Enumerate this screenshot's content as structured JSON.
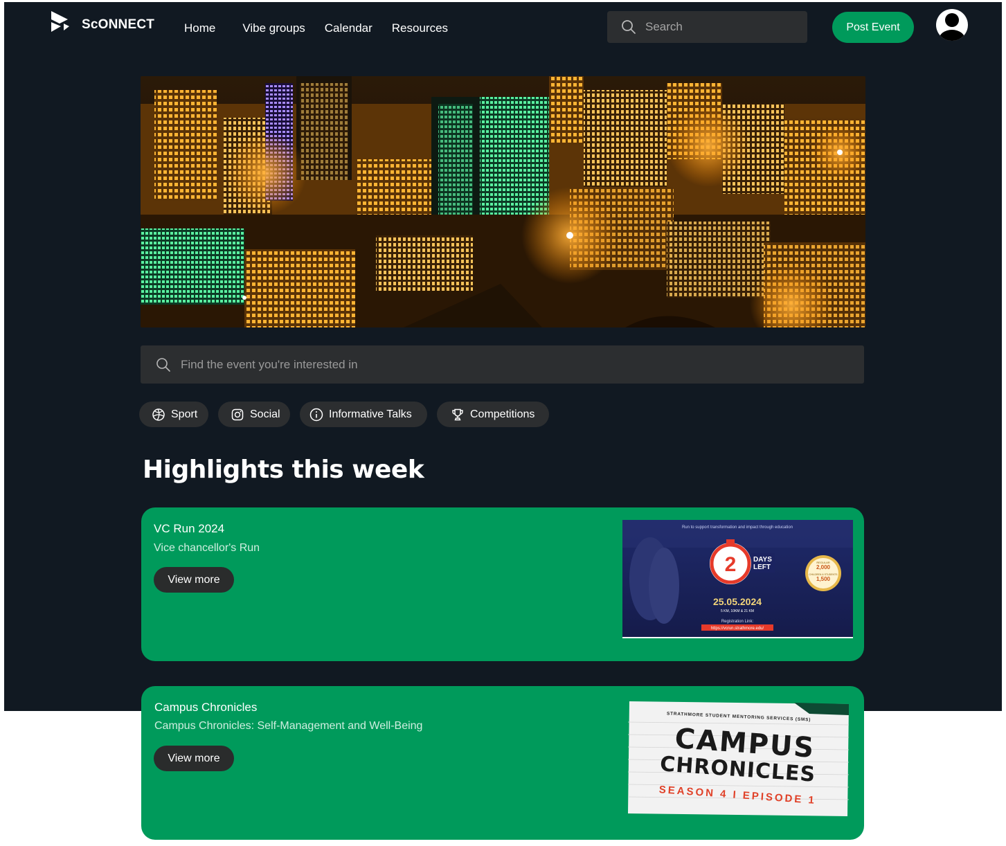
{
  "app": {
    "brand": "ScONNECT",
    "nav": [
      "Home",
      "Vibe groups",
      "Calendar",
      "Resources"
    ],
    "search_placeholder": "Search",
    "post_button": "Post Event"
  },
  "main": {
    "search_placeholder": "Find the event you're interested in",
    "categories": [
      {
        "label": "Sport",
        "icon": "basketball-icon"
      },
      {
        "label": "Social",
        "icon": "instagram-icon"
      },
      {
        "label": "Informative Talks",
        "icon": "info-icon"
      },
      {
        "label": "Competitions",
        "icon": "trophy-icon"
      }
    ],
    "section_title": "Highlights this week",
    "events": [
      {
        "title": "VC Run 2024",
        "subtitle": "Vice chancellor's Run",
        "button": "View more",
        "poster": {
          "tagline": "Run to support transformation and impact through education",
          "countdown": "2",
          "days_label": [
            "DAYS",
            "LEFT"
          ],
          "date": "25.05.2024",
          "distances": "5 KM, 10KM & 21 KM",
          "registration_label": "Registration Link:",
          "registration_url": "https://vcrun.strathmore.edu/",
          "price_regular_label": "REGULAR",
          "price_regular": "2,000",
          "price_student_label": "CHILDREN & STUDENTS",
          "price_student": "1,500"
        }
      },
      {
        "title": "Campus Chronicles",
        "subtitle": "Campus Chronicles: Self-Management and Well-Being",
        "button": "View more",
        "poster": {
          "org": "STRATHMORE STUDENT MENTORING SERVICES (SMS)",
          "line1": "CAMPUS",
          "line2": "CHRONICLES",
          "season": "SEASON 4   I   EPISODE 1"
        }
      }
    ]
  },
  "colors": {
    "background": "#111922",
    "accent": "#009a5b",
    "chip": "#2c2e30",
    "button_dark": "#2a2c2c"
  }
}
